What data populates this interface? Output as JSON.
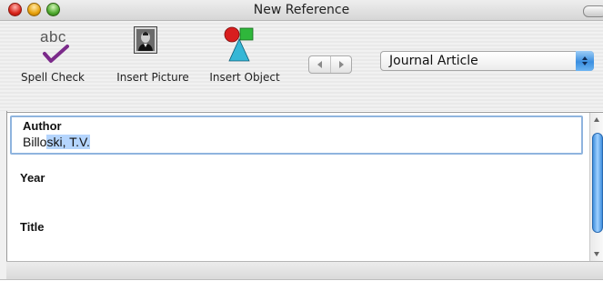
{
  "window": {
    "title": "New Reference"
  },
  "toolbar": {
    "spell_check": {
      "label": "Spell Check",
      "icon": "spell-check-icon",
      "icon_text": "abc"
    },
    "insert_picture": {
      "label": "Insert Picture",
      "icon": "portrait-icon"
    },
    "insert_object": {
      "label": "Insert Object",
      "icon": "shapes-icon"
    },
    "nav": {
      "prev_icon": "triangle-left-icon",
      "next_icon": "triangle-right-icon"
    },
    "reference_type": {
      "selected": "Journal Article"
    }
  },
  "fields": [
    {
      "label": "Author",
      "value_plain": "Billo",
      "value_selected": "ski, T.V."
    },
    {
      "label": "Year",
      "value": ""
    },
    {
      "label": "Title",
      "value": ""
    }
  ],
  "colors": {
    "focus_ring": "#8fb4de",
    "selection": "#b5d5fd",
    "popup_arrows": "#3b8fe0"
  }
}
